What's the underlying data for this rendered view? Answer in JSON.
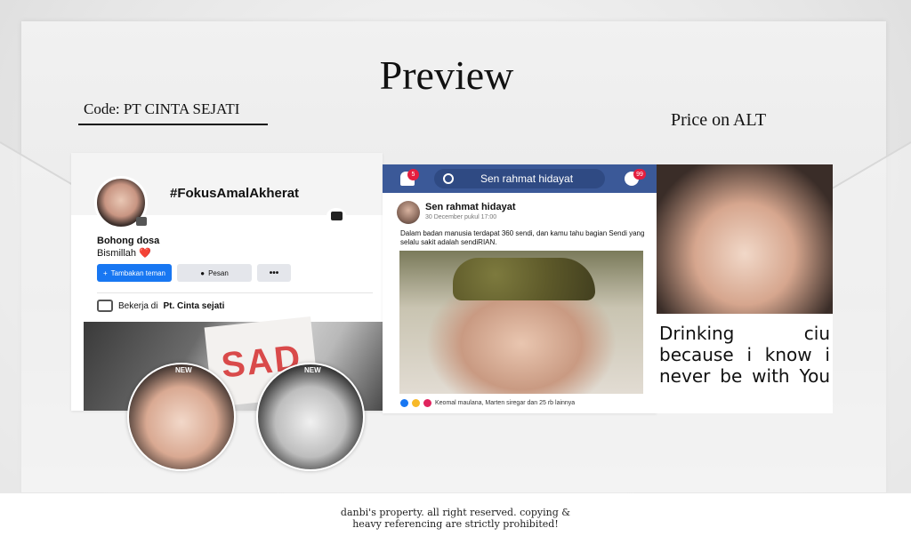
{
  "title": "Preview",
  "code": "Code: PT CINTA SEJATI",
  "price": "Price on ALT",
  "profile_card": {
    "hashtag": "#FokusAmalAkherat",
    "name": "Bohong dosa",
    "bio": "Bismillah",
    "bio_emoji": "❤️",
    "buttons": {
      "add_friend": "Tambakan teman",
      "message": "Pesan",
      "more": "•••"
    },
    "work_prefix": "Bekerja di",
    "work_company": "Pt. Cinta sejati",
    "photo_sign_text": "SAD"
  },
  "circles": [
    {
      "tag": "NEW"
    },
    {
      "tag": "NEW"
    }
  ],
  "post": {
    "bell_badge": "5",
    "search_text": "Sen rahmat hidayat",
    "messenger_badge": "99",
    "author": "Sen rahmat hidayat",
    "time": "30 December pukul 17:00",
    "text": "Dalam badan manusia terdapat 360 sendi, dan kamu tahu bagian Sendi yang selalu sakit adalah sendiRIAN.",
    "reactions": "Keomal maulana, Marten siregar dan 25 rb lainnya",
    "colors": {
      "fb_blue": "#3b5998",
      "badge_red": "#e41e3f"
    }
  },
  "quote": {
    "text": "Drinking ciu because i know i never be with You"
  },
  "footer": {
    "line1": "danbi's property. all right reserved. copying &",
    "line2": "heavy referencing are strictly prohibited!"
  }
}
